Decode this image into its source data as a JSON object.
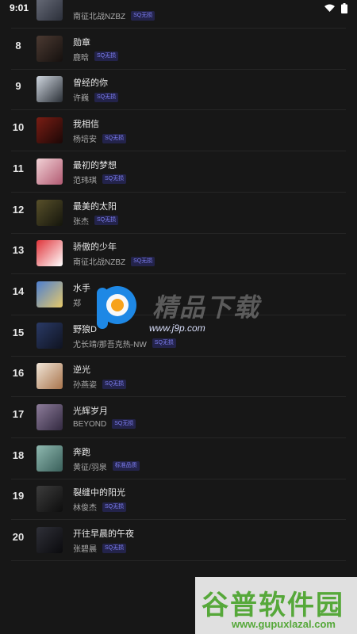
{
  "status": {
    "time": "9:01"
  },
  "rows": [
    {
      "rank": "",
      "title": "",
      "artist": "南征北战NZBZ",
      "badge": "SQ无损",
      "colors": [
        "#6b6f7c",
        "#2b2f3a"
      ]
    },
    {
      "rank": "8",
      "title": "勋章",
      "artist": "鹿晗",
      "badge": "SQ无损",
      "colors": [
        "#4b3a32",
        "#15100e"
      ]
    },
    {
      "rank": "9",
      "title": "曾经的你",
      "artist": "许巍",
      "badge": "SQ无损",
      "colors": [
        "#cfd6df",
        "#2a2f36"
      ]
    },
    {
      "rank": "10",
      "title": "我相信",
      "artist": "杨培安",
      "badge": "SQ无损",
      "colors": [
        "#7a1d14",
        "#1b0706"
      ]
    },
    {
      "rank": "11",
      "title": "最初的梦想",
      "artist": "范玮琪",
      "badge": "SQ无损",
      "colors": [
        "#f2d2d6",
        "#b15a72"
      ]
    },
    {
      "rank": "12",
      "title": "最美的太阳",
      "artist": "张杰",
      "badge": "SQ无损",
      "colors": [
        "#58502a",
        "#14150c"
      ]
    },
    {
      "rank": "13",
      "title": "骄傲的少年",
      "artist": "南征北战NZBZ",
      "badge": "SQ无损",
      "colors": [
        "#e0343a",
        "#ffffff"
      ]
    },
    {
      "rank": "14",
      "title": "水手",
      "artist": "郑",
      "badge": "",
      "colors": [
        "#4d7fd0",
        "#e6c96a"
      ]
    },
    {
      "rank": "15",
      "title": "野狼D",
      "artist": "尤长靖/那吾克热-NW",
      "badge": "SQ无损",
      "colors": [
        "#2a3a66",
        "#0f1320"
      ]
    },
    {
      "rank": "16",
      "title": "逆光",
      "artist": "孙燕姿",
      "badge": "SQ无损",
      "colors": [
        "#f1e6d8",
        "#a8744c"
      ]
    },
    {
      "rank": "17",
      "title": "光辉岁月",
      "artist": "BEYOND",
      "badge": "SQ无损",
      "colors": [
        "#8d7c9a",
        "#322940"
      ]
    },
    {
      "rank": "18",
      "title": "奔跑",
      "artist": "黄征/羽泉",
      "badge": "标准品质",
      "colors": [
        "#8fb9b0",
        "#395f5a"
      ]
    },
    {
      "rank": "19",
      "title": "裂缝中的阳光",
      "artist": "林俊杰",
      "badge": "SQ无损",
      "colors": [
        "#3c3c3c",
        "#0d0d0d"
      ]
    },
    {
      "rank": "20",
      "title": "开往早晨的午夜",
      "artist": "张碧晨",
      "badge": "SQ无损",
      "colors": [
        "#2f3038",
        "#0a0a0d"
      ]
    }
  ],
  "watermark": {
    "title": "精品下载",
    "url": "www.j9p.com",
    "bottom_title": "谷普软件园",
    "bottom_url": "www.gupuxlazal.com"
  }
}
